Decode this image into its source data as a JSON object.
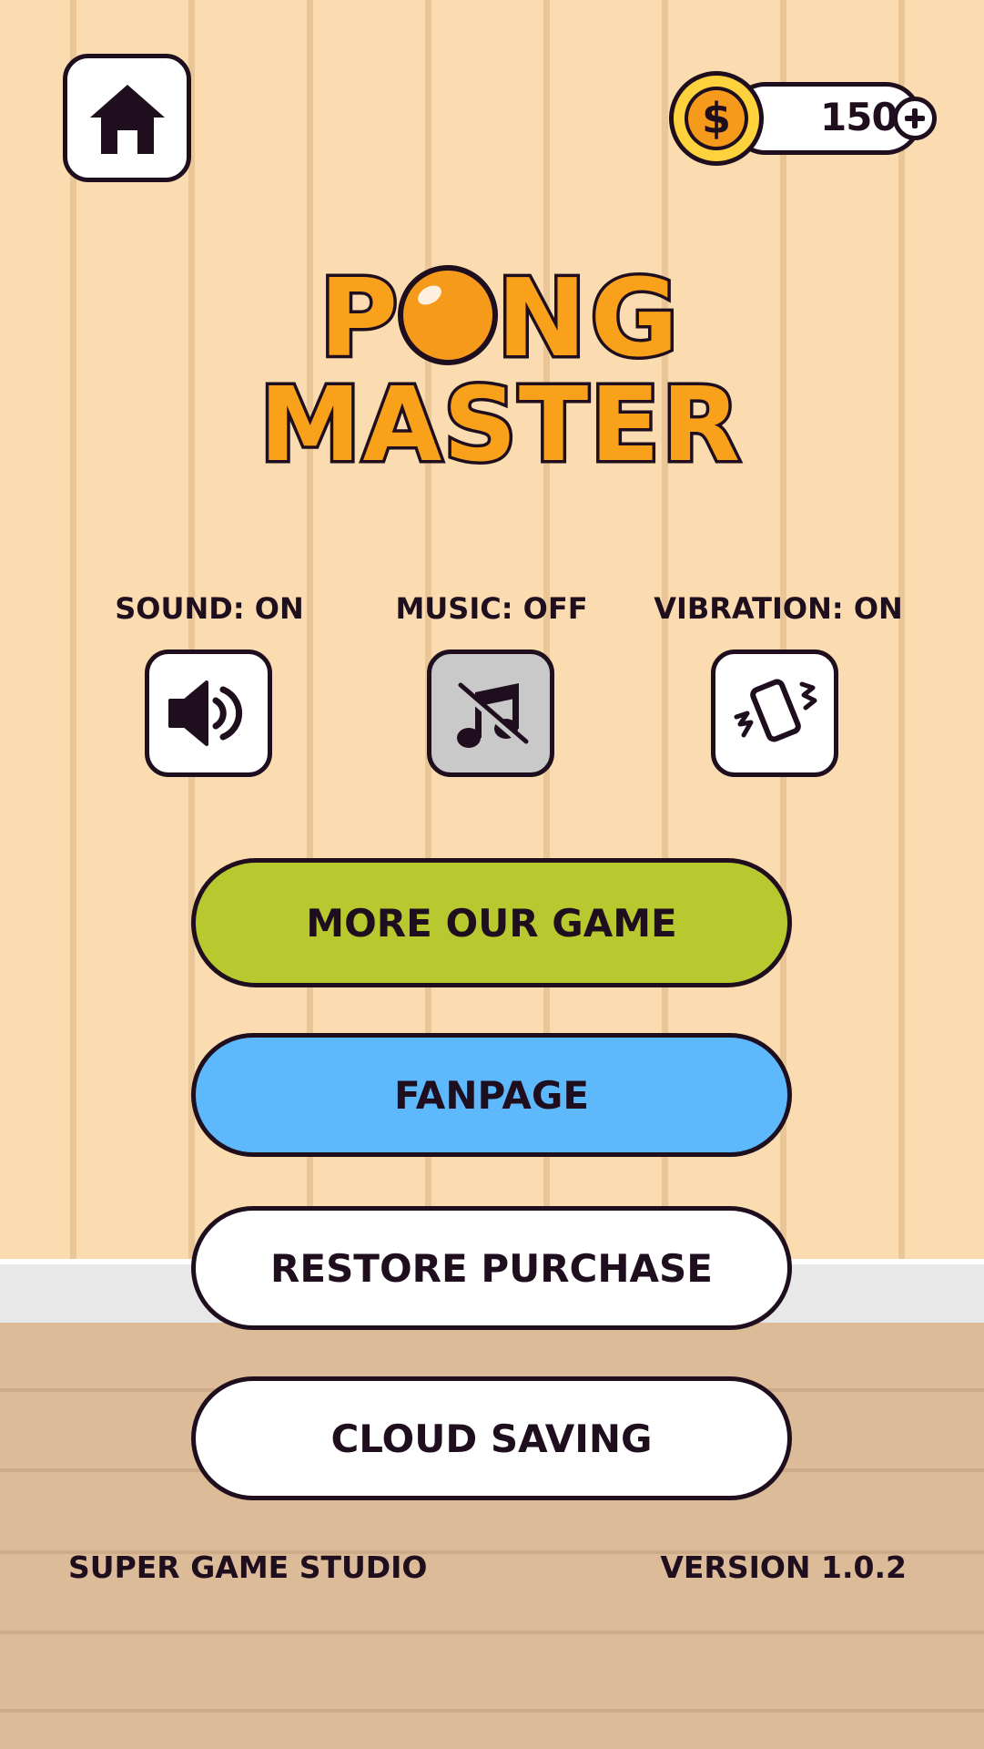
{
  "currency": {
    "amount": "150",
    "coin_icon": "dollar-coin-icon",
    "add_icon": "plus-icon"
  },
  "logo": {
    "line1": "PONG",
    "line2": "MASTER"
  },
  "settings": [
    {
      "label": "SOUND: ON",
      "icon": "speaker-icon",
      "state": "on"
    },
    {
      "label": "MUSIC: OFF",
      "icon": "music-off-icon",
      "state": "off"
    },
    {
      "label": "VIBRATION: ON",
      "icon": "vibration-icon",
      "state": "on"
    }
  ],
  "buttons": {
    "more_games": "MORE OUR GAME",
    "fanpage": "FANPAGE",
    "restore": "RESTORE PURCHASE",
    "cloud": "CLOUD SAVING"
  },
  "footer": {
    "studio": "SUPER GAME STUDIO",
    "version": "VERSION 1.0.2"
  },
  "colors": {
    "wall": "#fadcb0",
    "floor": "#dcbb98",
    "outline": "#1e0e1e",
    "green_button": "#b7c92f",
    "blue_button": "#5db9fb",
    "white_button": "#ffffff",
    "disabled_button": "#c9c9c9",
    "logo_orange": "#f9a11b",
    "coin_gold": "#fed23c"
  }
}
